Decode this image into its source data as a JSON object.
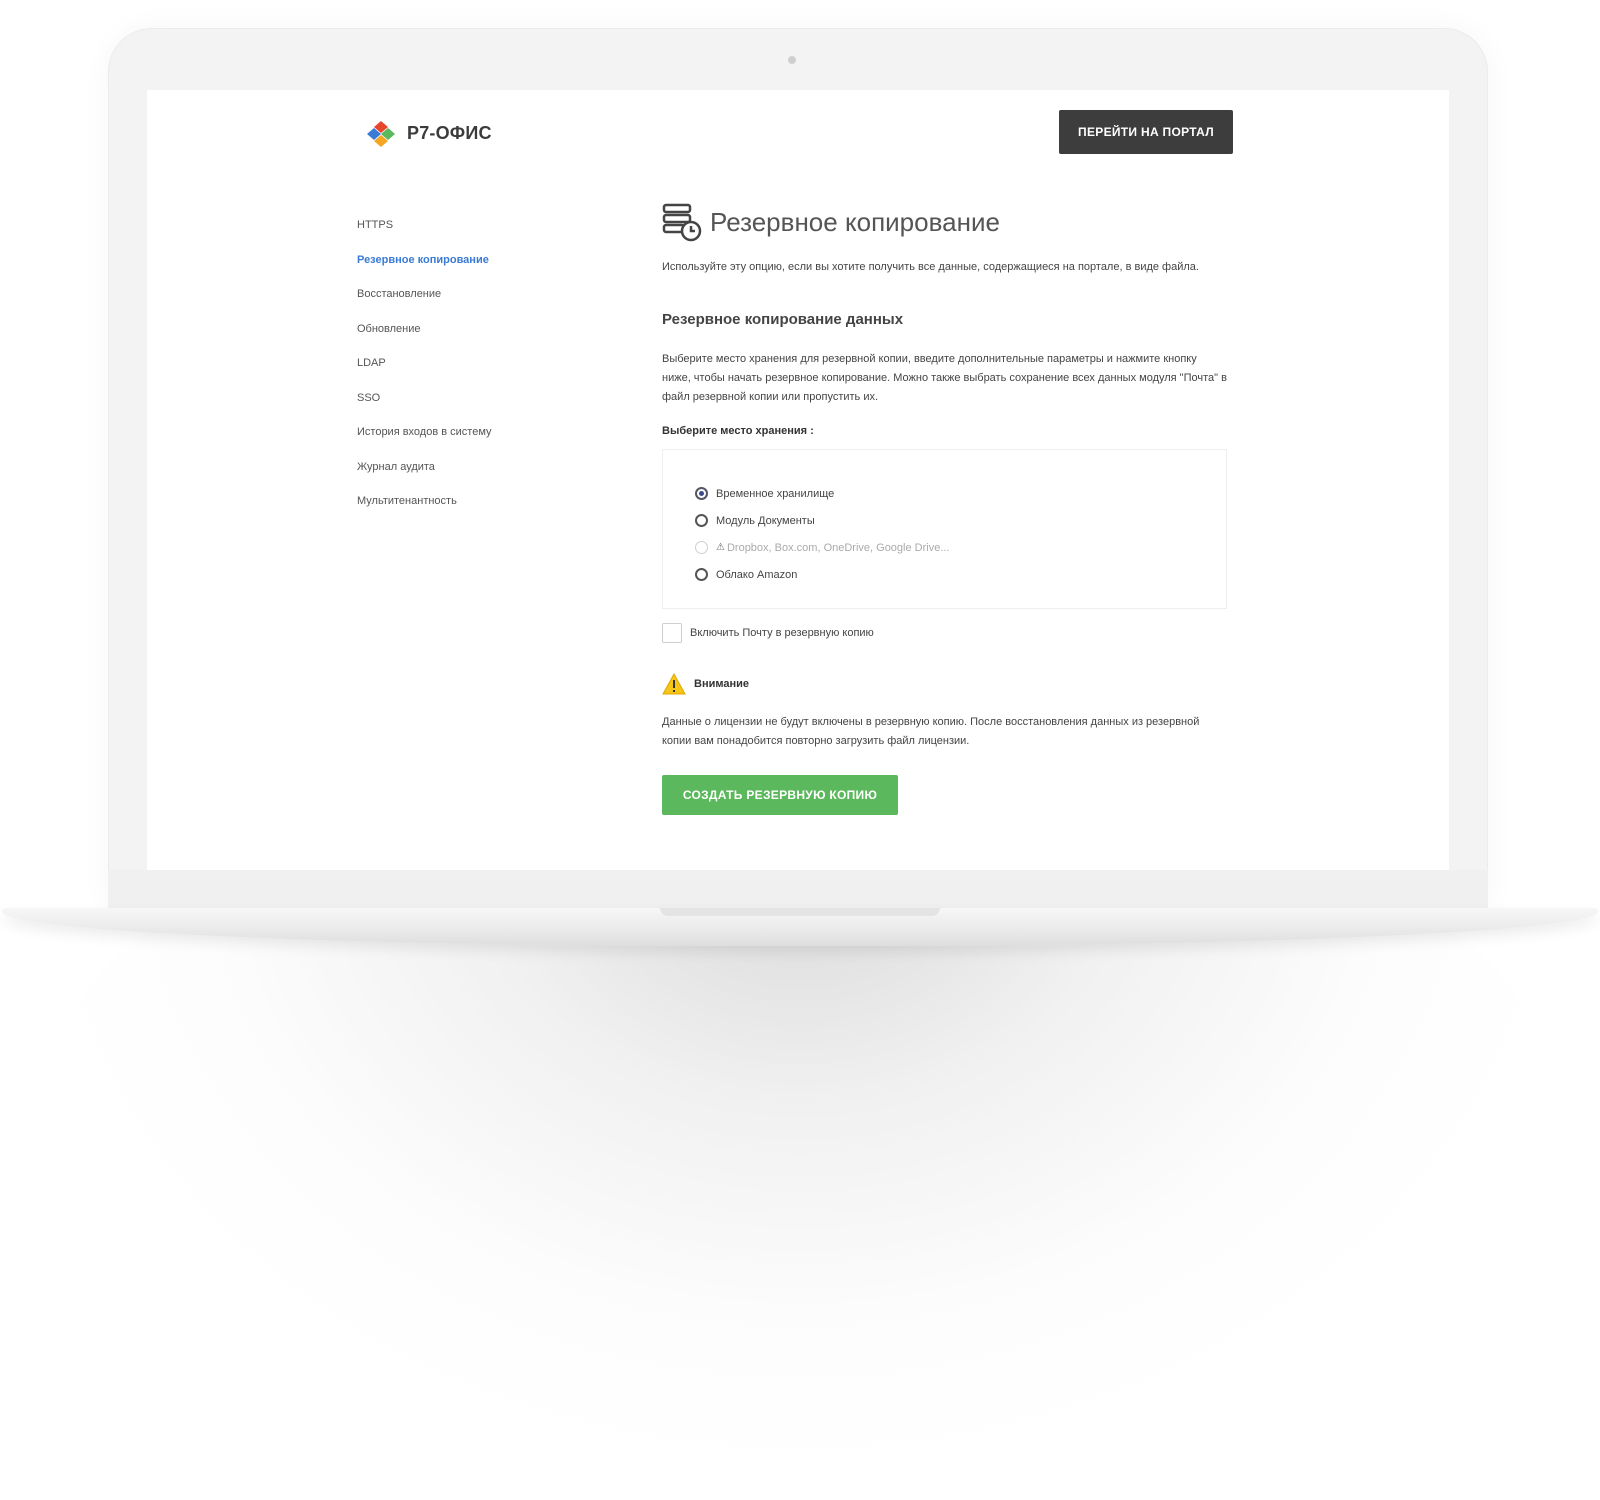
{
  "brand": {
    "name": "Р7-ОФИС"
  },
  "header": {
    "portal_button": "ПЕРЕЙТИ НА ПОРТАЛ"
  },
  "sidebar": {
    "items": [
      {
        "label": "HTTPS",
        "active": false
      },
      {
        "label": "Резервное копирование",
        "active": true
      },
      {
        "label": "Восстановление",
        "active": false
      },
      {
        "label": "Обновление",
        "active": false
      },
      {
        "label": "LDAP",
        "active": false
      },
      {
        "label": "SSO",
        "active": false
      },
      {
        "label": "История входов в систему",
        "active": false
      },
      {
        "label": "Журнал аудита",
        "active": false
      },
      {
        "label": "Мультитенантность",
        "active": false
      }
    ]
  },
  "main": {
    "title": "Резервное копирование",
    "description": "Используйте эту опцию, если вы хотите получить все данные, содержащиеся на портале, в виде файла.",
    "section_title": "Резервное копирование данных",
    "section_description": "Выберите место хранения для резервной копии, введите дополнительные параметры и нажмите кнопку ниже, чтобы начать резервное копирование. Можно также выбрать сохранение всех данных модуля \"Почта\" в файл резервной копии или пропустить их.",
    "storage_label": "Выберите место хранения :",
    "storage_options": [
      {
        "label": "Временное хранилище",
        "checked": true,
        "disabled": false
      },
      {
        "label": "Модуль Документы",
        "checked": false,
        "disabled": false
      },
      {
        "label": "Dropbox, Box.com, OneDrive, Google Drive...",
        "checked": false,
        "disabled": true
      },
      {
        "label": "Облако Amazon",
        "checked": false,
        "disabled": false
      }
    ],
    "include_mail_label": "Включить Почту в резервную копию",
    "include_mail_checked": false,
    "attention_title": "Внимание",
    "attention_text": "Данные о лицензии не будут включены в резервную копию. После восстановления данных из резервной копии вам понадобится повторно загрузить файл лицензии.",
    "create_button": "СОЗДАТЬ РЕЗЕРВНУЮ КОПИЮ"
  },
  "colors": {
    "accent": "#3a7bd5",
    "primary_button": "#3d3d3d",
    "create_button": "#5cb85c",
    "warning": "#f5c518"
  }
}
